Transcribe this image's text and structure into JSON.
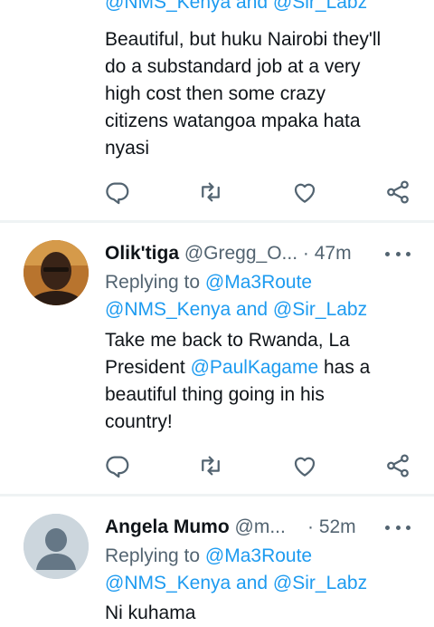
{
  "tweets": [
    {
      "mention_line": "@NMS_Kenya and @Sir_Labz",
      "body_lines": [
        "Beautiful, but huku Nairobi they'll",
        "do a substandard job at a very",
        "high cost then some crazy",
        "citizens watangoa mpaka hata",
        "nyasi"
      ]
    },
    {
      "name": "Olik'tiga",
      "handle": "@Gregg_O...",
      "time": "· 47m",
      "replying_prefix": "Replying to ",
      "replying_first": "@Ma3Route",
      "replying_line2": "@NMS_Kenya and @Sir_Labz",
      "body_line1": "Take me back to Rwanda, La",
      "body_line2_pre": "President ",
      "body_line2_mention": "@PaulKagame",
      "body_line2_post": " has a",
      "body_line3": "beautiful thing going in his",
      "body_line4": "country!"
    },
    {
      "name": "Angela Mumo",
      "handle": "@m...",
      "time": "· 52m",
      "replying_prefix": "Replying to ",
      "replying_first": "@Ma3Route",
      "replying_line2": "@NMS_Kenya and @Sir_Labz",
      "body_line1": "Ni kuhama"
    }
  ],
  "icons": {
    "reply": "reply-icon",
    "retweet": "retweet-icon",
    "like": "like-icon",
    "share": "share-icon",
    "more": "more-icon"
  },
  "colors": {
    "text": "#0f1419",
    "secondary": "#536471",
    "link": "#1d9bf0",
    "separator": "#eff3f4"
  }
}
